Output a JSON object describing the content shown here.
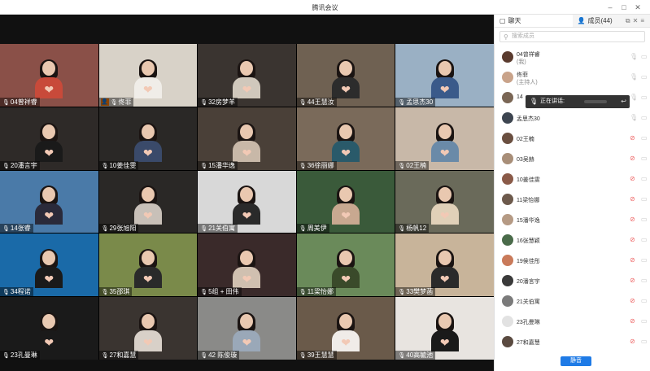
{
  "window": {
    "title": "腾讯会议"
  },
  "sidebar": {
    "tab_chat": "聊天",
    "tab_members": "成员(44)",
    "search_placeholder": "搜索成员",
    "speaking_prefix": "正在讲话:",
    "mute_all": "静音",
    "members": [
      {
        "name": "04曾祥睿",
        "role": "(我)",
        "color": "#5a3b2e",
        "mic_muted": false
      },
      {
        "name": "佟菲",
        "role": "(主持人)",
        "color": "#c9a38a",
        "mic_muted": false
      },
      {
        "name": "14",
        "role": "",
        "color": "#7a6655",
        "mic_muted": false
      },
      {
        "name": "孟思杰30",
        "role": "",
        "color": "#3d4550",
        "mic_muted": false
      },
      {
        "name": "02王楠",
        "role": "",
        "color": "#6a4f40",
        "mic_muted": true
      },
      {
        "name": "03吴赫",
        "role": "",
        "color": "#a88e78",
        "mic_muted": true
      },
      {
        "name": "10姜佳雯",
        "role": "",
        "color": "#8a5a48",
        "mic_muted": true
      },
      {
        "name": "11梁怡娜",
        "role": "",
        "color": "#6d5a4c",
        "mic_muted": true
      },
      {
        "name": "15潘华逸",
        "role": "",
        "color": "#b59a84",
        "mic_muted": true
      },
      {
        "name": "16张慧颖",
        "role": "",
        "color": "#4a6b4a",
        "mic_muted": true
      },
      {
        "name": "19侯佳彤",
        "role": "",
        "color": "#c97a5a",
        "mic_muted": true
      },
      {
        "name": "20潘言宇",
        "role": "",
        "color": "#3a3a3a",
        "mic_muted": true
      },
      {
        "name": "21关伯寓",
        "role": "",
        "color": "#7b7b7b",
        "mic_muted": true
      },
      {
        "name": "23孔曼琳",
        "role": "",
        "color": "#e2e2e2",
        "mic_muted": true
      },
      {
        "name": "27和嘉慧",
        "role": "",
        "color": "#5a4a40",
        "mic_muted": true
      }
    ]
  },
  "tiles": [
    {
      "label": "04曾祥睿",
      "bg": "#8a5048",
      "shirt": "#c84a3a"
    },
    {
      "label": "佟菲",
      "bg": "#d8d2c8",
      "shirt": "#f0ede8",
      "host": true
    },
    {
      "label": "32房梦羊",
      "bg": "#3a3430",
      "shirt": "#d0c8bc"
    },
    {
      "label": "44王慧汝",
      "bg": "#6f6152",
      "shirt": "#2c2c2c"
    },
    {
      "label": "孟思杰30",
      "bg": "#9ab0c4",
      "shirt": "#3a5a8a"
    },
    {
      "label": "20潘言宇",
      "bg": "#2e2a28",
      "shirt": "#1a1a1a"
    },
    {
      "label": "10姜佳雯",
      "bg": "#2a2826",
      "shirt": "#3a4a6a"
    },
    {
      "label": "15潘华逸",
      "bg": "#4a4038",
      "shirt": "#c8b8a8"
    },
    {
      "label": "36徐丽娜",
      "bg": "#7a6a5a",
      "shirt": "#2a5a6a"
    },
    {
      "label": "02王楠",
      "bg": "#c8b8a8",
      "shirt": "#6a8aa8"
    },
    {
      "label": "14张睿",
      "bg": "#4a7aa8",
      "shirt": "#2a2a3a"
    },
    {
      "label": "29张旭阳",
      "bg": "#2a2826",
      "shirt": "#c8c0b8"
    },
    {
      "label": "21关伯寓",
      "bg": "#d8d8d8",
      "shirt": "#2a2a2a"
    },
    {
      "label": "周美伊",
      "bg": "#3a5a3a",
      "shirt": "#c8a890"
    },
    {
      "label": "杨帆12",
      "bg": "#6a6a5a",
      "shirt": "#e0d0b8"
    },
    {
      "label": "34程诺",
      "bg": "#1a6aa8",
      "shirt": "#1a1a1a"
    },
    {
      "label": "35邵琪",
      "bg": "#7a8a4a",
      "shirt": "#2a2a2a"
    },
    {
      "label": "5组 + 田伟",
      "bg": "#3a2a2a",
      "shirt": "#d0c0b0"
    },
    {
      "label": "11梁怡娜",
      "bg": "#6a8a5a",
      "shirt": "#3a4a2a"
    },
    {
      "label": "33樊梦菡",
      "bg": "#c8b49a",
      "shirt": "#2a2a2a"
    },
    {
      "label": "23孔曼琳",
      "bg": "#1a1a1a",
      "shirt": "#1a1a1a"
    },
    {
      "label": "27和嘉慧",
      "bg": "#3a3430",
      "shirt": "#d8d0c8"
    },
    {
      "label": "42 陈俊璇",
      "bg": "#8a8a88",
      "shirt": "#9aa8b8"
    },
    {
      "label": "39王慧慧",
      "bg": "#6a5a4a",
      "shirt": "#f0ece8"
    },
    {
      "label": "40高毓池",
      "bg": "#e8e4e0",
      "shirt": "#1a1a1a"
    }
  ]
}
